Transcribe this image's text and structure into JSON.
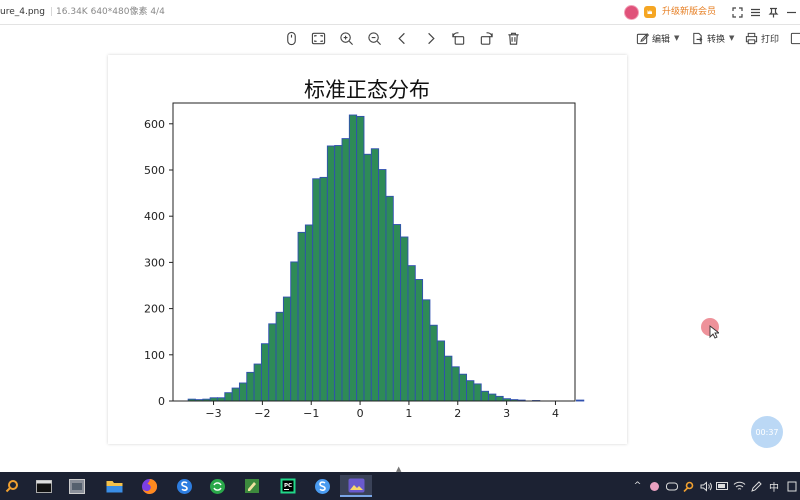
{
  "titlebar": {
    "filename": "ure_4.png",
    "file_size": "16.34K",
    "dimensions": "640*480像素",
    "page_index": "4/4",
    "vip_label": "升级新版会员",
    "avatar_label": "□"
  },
  "toolbar": {
    "edit_label": "编辑",
    "convert_label": "转换",
    "print_label": "打印"
  },
  "chart_data": {
    "type": "bar",
    "title": "标准正态分布",
    "xlabel": "",
    "ylabel": "",
    "xlim": [
      -3.83,
      4.4
    ],
    "ylim": [
      0,
      645
    ],
    "xticks": [
      -3,
      -2,
      -1,
      0,
      1,
      2,
      3,
      4
    ],
    "yticks": [
      0,
      100,
      200,
      300,
      400,
      500,
      600
    ],
    "xtick_labels": [
      "−3",
      "−2",
      "−1",
      "0",
      "1",
      "2",
      "3",
      "4"
    ],
    "ytick_labels": [
      "0",
      "100",
      "200",
      "300",
      "400",
      "500",
      "600"
    ],
    "bin_start": -3.52,
    "bin_width": 0.15,
    "values": [
      4,
      3,
      4,
      7,
      7,
      18,
      28,
      39,
      62,
      80,
      124,
      167,
      192,
      225,
      301,
      365,
      381,
      481,
      484,
      552,
      553,
      568,
      619,
      616,
      534,
      546,
      501,
      443,
      382,
      355,
      293,
      263,
      219,
      164,
      130,
      97,
      74,
      58,
      44,
      37,
      21,
      15,
      10,
      5,
      3,
      2,
      0,
      1,
      0,
      0,
      0,
      0,
      0,
      2
    ],
    "grid": false,
    "bar_color": "#2e8b57",
    "edge_color": "#3050b0"
  },
  "viewer": {
    "timer": "00:37"
  },
  "taskbar": {
    "lang": "中"
  }
}
